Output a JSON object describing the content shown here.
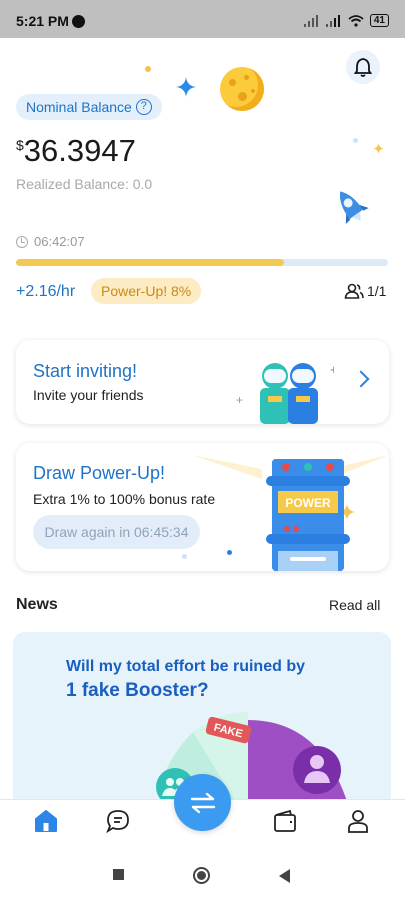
{
  "status_bar": {
    "time": "5:21 PM",
    "battery": "41"
  },
  "balance": {
    "nominal_label": "Nominal Balance",
    "currency_symbol": "$",
    "amount": "36.3947",
    "realized": "Realized Balance: 0.0",
    "timer": "06:42:07",
    "progress": 0.72,
    "rate": "+2.16/hr",
    "powerup": "Power-Up! 8%",
    "team": "1/1"
  },
  "invite_card": {
    "title": "Start inviting!",
    "subtitle": "Invite your friends"
  },
  "draw_card": {
    "title": "Draw Power-Up!",
    "subtitle": "Extra 1% to 100% bonus rate",
    "button": "Draw again in 06:45:34",
    "machine_label": "POWER"
  },
  "news": {
    "title": "News",
    "read_all": "Read all",
    "banner_line1": "Will my total effort be ruined by",
    "banner_line2": "1 fake Booster?",
    "fake_tag": "FAKE"
  },
  "colors": {
    "accent": "#1f73c8",
    "fab": "#3b9bf0",
    "progress": "#f4c94f"
  },
  "nav_icons": [
    "home-icon",
    "chat-icon",
    "swap-icon",
    "wallet-icon",
    "profile-icon"
  ]
}
